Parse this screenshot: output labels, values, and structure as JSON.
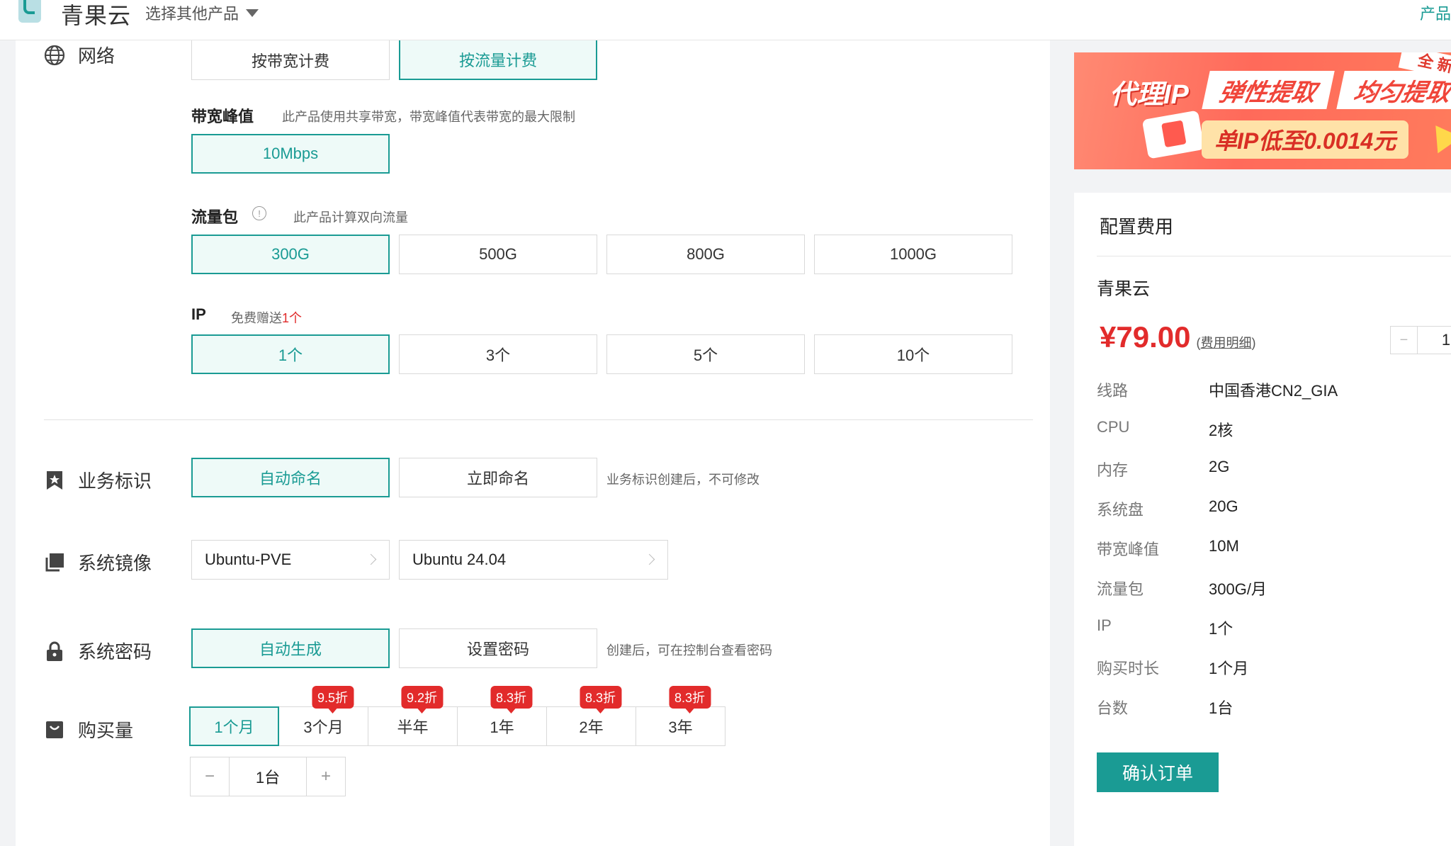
{
  "header": {
    "brand": "青果云",
    "product_switch": "选择其他产品",
    "right_link": "产品"
  },
  "network": {
    "label": "网络",
    "billing_options": [
      "按带宽计费",
      "按流量计费"
    ],
    "selected_billing": "按流量计费",
    "bandwidth": {
      "title": "带宽峰值",
      "hint": "此产品使用共享带宽，带宽峰值代表带宽的最大限制",
      "value": "10Mbps"
    },
    "traffic": {
      "title": "流量包",
      "hint": "此产品计算双向流量",
      "options": [
        "300G",
        "500G",
        "800G",
        "1000G"
      ],
      "selected": "300G"
    },
    "ip": {
      "title": "IP",
      "hint_prefix": "免费赠送",
      "hint_red": "1个",
      "options": [
        "1个",
        "3个",
        "5个",
        "10个"
      ],
      "selected": "1个"
    }
  },
  "business_id": {
    "label": "业务标识",
    "options": [
      "自动命名",
      "立即命名"
    ],
    "selected": "自动命名",
    "hint": "业务标识创建后，不可修改"
  },
  "system_image": {
    "label": "系统镜像",
    "type": "Ubuntu-PVE",
    "version": "Ubuntu 24.04"
  },
  "system_password": {
    "label": "系统密码",
    "options": [
      "自动生成",
      "设置密码"
    ],
    "selected": "自动生成",
    "hint": "创建后，可在控制台查看密码"
  },
  "purchase": {
    "label": "购买量",
    "durations": [
      {
        "label": "1个月",
        "discount": ""
      },
      {
        "label": "3个月",
        "discount": "9.5折"
      },
      {
        "label": "半年",
        "discount": "9.2折"
      },
      {
        "label": "1年",
        "discount": "8.3折"
      },
      {
        "label": "2年",
        "discount": "8.3折"
      },
      {
        "label": "3年",
        "discount": "8.3折"
      }
    ],
    "selected_duration": "1个月",
    "quantity": "1台",
    "minus": "−",
    "plus": "+"
  },
  "banner": {
    "title1": "代理IP",
    "title2": "弹性提取",
    "title3": "均匀提取",
    "tag": "全 新",
    "promo": "单IP低至0.0014元"
  },
  "summary": {
    "title": "配置费用",
    "product": "青果云",
    "price": "¥79.00",
    "detail_open": "(",
    "detail_link": "费用明细",
    "detail_close": ")",
    "qty_minus": "−",
    "qty_value": "1",
    "specs": [
      {
        "k": "线路",
        "v": "中国香港CN2_GIA"
      },
      {
        "k": "CPU",
        "v": "2核"
      },
      {
        "k": "内存",
        "v": "2G"
      },
      {
        "k": "系统盘",
        "v": "20G"
      },
      {
        "k": "带宽峰值",
        "v": "10M"
      },
      {
        "k": "流量包",
        "v": "300G/月"
      },
      {
        "k": "IP",
        "v": "1个"
      },
      {
        "k": "购买时长",
        "v": "1个月"
      },
      {
        "k": "台数",
        "v": "1台"
      }
    ],
    "confirm": "确认订单"
  },
  "colors": {
    "accent": "#1a9b94",
    "price_red": "#e22b2b",
    "selected_bg": "#eefaf8"
  }
}
